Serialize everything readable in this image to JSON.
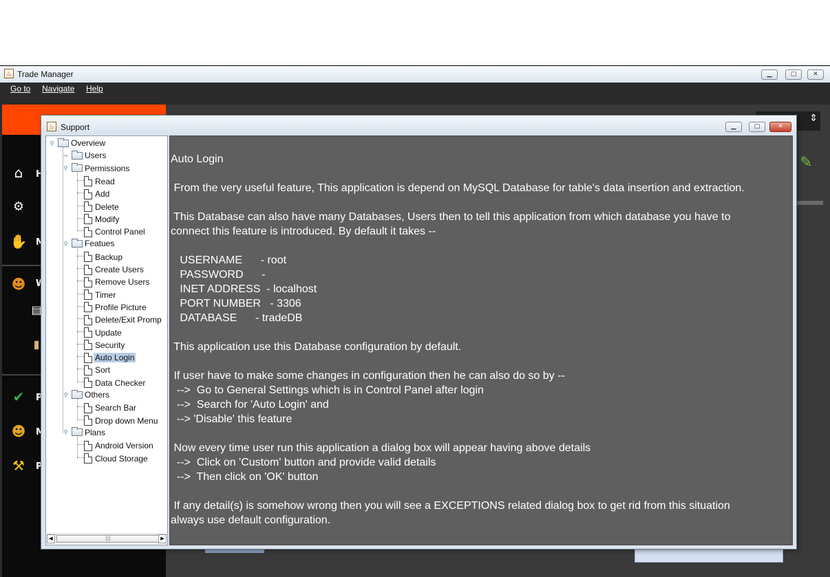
{
  "main_window": {
    "title": "Trade Manager",
    "menu": [
      "Go to",
      "Navigate",
      "Help"
    ],
    "sidebar_partial_labels": [
      "H",
      "M",
      "W",
      "P",
      "M",
      "P"
    ]
  },
  "support_dialog": {
    "title": "Support",
    "tree": [
      {
        "label": "Overview",
        "type": "folder",
        "level": 0,
        "expanded": true
      },
      {
        "label": "Users",
        "type": "folder",
        "level": 1,
        "expanded": false
      },
      {
        "label": "Permissions",
        "type": "folder",
        "level": 1,
        "expanded": true
      },
      {
        "label": "Read",
        "type": "leaf",
        "level": 2
      },
      {
        "label": "Add",
        "type": "leaf",
        "level": 2
      },
      {
        "label": "Delete",
        "type": "leaf",
        "level": 2
      },
      {
        "label": "Modify",
        "type": "leaf",
        "level": 2
      },
      {
        "label": "Control Panel",
        "type": "leaf",
        "level": 2
      },
      {
        "label": "Featues",
        "type": "folder",
        "level": 1,
        "expanded": true
      },
      {
        "label": "Backup",
        "type": "leaf",
        "level": 2
      },
      {
        "label": "Create Users",
        "type": "leaf",
        "level": 2
      },
      {
        "label": "Remove Users",
        "type": "leaf",
        "level": 2
      },
      {
        "label": "Timer",
        "type": "leaf",
        "level": 2
      },
      {
        "label": "Profile Picture",
        "type": "leaf",
        "level": 2
      },
      {
        "label": "Delete/Exit Promp",
        "type": "leaf",
        "level": 2
      },
      {
        "label": "Update",
        "type": "leaf",
        "level": 2
      },
      {
        "label": "Security",
        "type": "leaf",
        "level": 2
      },
      {
        "label": "Auto Login",
        "type": "leaf",
        "level": 2,
        "selected": true
      },
      {
        "label": "Sort",
        "type": "leaf",
        "level": 2
      },
      {
        "label": "Data Checker",
        "type": "leaf",
        "level": 2
      },
      {
        "label": "Others",
        "type": "folder",
        "level": 1,
        "expanded": true
      },
      {
        "label": "Search Bar",
        "type": "leaf",
        "level": 2
      },
      {
        "label": "Drop down Menu",
        "type": "leaf",
        "level": 2
      },
      {
        "label": "Plans",
        "type": "folder",
        "level": 1,
        "expanded": true
      },
      {
        "label": "Android Version",
        "type": "leaf",
        "level": 2
      },
      {
        "label": "Cloud Storage",
        "type": "leaf",
        "level": 2
      }
    ],
    "content_lines": [
      "Auto Login",
      "",
      " From the very useful feature, This application is depend on MySQL Database for table's data insertion and extraction.",
      "",
      " This Database can also have many Databases, Users then to tell this application from which database you have to",
      "connect this feature is introduced. By default it takes --",
      "",
      "   USERNAME      - root",
      "   PASSWORD      -",
      "   INET ADDRESS  - localhost",
      "   PORT NUMBER   - 3306",
      "   DATABASE      - tradeDB",
      "",
      " This application use this Database configuration by default.",
      "",
      " If user have to make some changes in configuration then he can also do so by --",
      "  -->  Go to General Settings which is in Control Panel after login",
      "  -->  Search for 'Auto Login' and",
      "  --> 'Disable' this feature",
      "",
      " Now every time user run this application a dialog box will appear having above details",
      "  -->  Click on 'Custom' button and provide valid details",
      "  -->  Then click on 'OK' button",
      "",
      " If any detail(s) is somehow wrong then you will see a EXCEPTIONS related dialog box to get rid from this situation",
      "always use default configuration."
    ]
  }
}
